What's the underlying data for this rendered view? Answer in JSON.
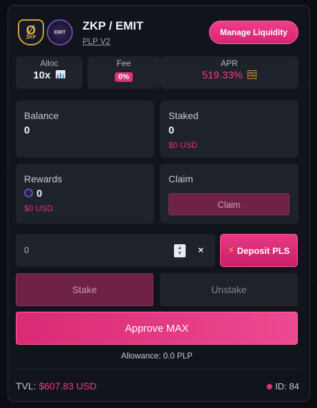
{
  "pair": {
    "title": "ZKP / EMIT",
    "subtitle": "PLP V2",
    "logo_left_text": "ZKP",
    "logo_right_text": "EMIT"
  },
  "header": {
    "manage_label": "Manage Liquidity"
  },
  "stats": {
    "alloc": {
      "label": "Alloc",
      "value": "10x",
      "icon": "bar-chart-icon"
    },
    "fee": {
      "label": "Fee",
      "value": "0%"
    },
    "apr": {
      "label": "APR",
      "value": "519.33%",
      "icon": "abacus-icon"
    }
  },
  "balance": {
    "label": "Balance",
    "value": "0"
  },
  "staked": {
    "label": "Staked",
    "value": "0",
    "usd": "$0 USD"
  },
  "rewards": {
    "label": "Rewards",
    "value": "0",
    "usd": "$0 USD"
  },
  "claim": {
    "label": "Claim",
    "button_label": "Claim"
  },
  "amount_input": {
    "value": "0"
  },
  "deposit": {
    "label": "Deposit PLS",
    "icon": "lightning-icon"
  },
  "actions": {
    "stake_label": "Stake",
    "unstake_label": "Unstake",
    "approve_label": "Approve MAX"
  },
  "allowance": "Allowance: 0.0 PLP",
  "footer": {
    "tvl_label": "TVL:",
    "tvl_value": "$607.83 USD",
    "id_label": "ID: 84"
  },
  "colors": {
    "accent": "#e0307a",
    "panel": "#1e222b",
    "card": "#11141b"
  }
}
